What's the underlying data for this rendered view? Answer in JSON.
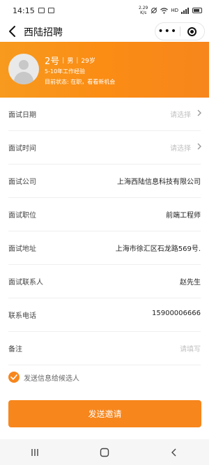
{
  "statusbar": {
    "time": "14:15",
    "speed_top": "2.29",
    "speed_bottom": "K/s",
    "network_label": "HD"
  },
  "nav": {
    "title": "西陆招聘",
    "more_glyph": "•••"
  },
  "candidate": {
    "name": "2号",
    "gender": "男",
    "age": "29岁",
    "experience": "5-10年工作经验",
    "status": "目前状态: 在职，看看新机会"
  },
  "form": {
    "rows": [
      {
        "label": "面试日期",
        "value": "请选择",
        "placeholder": true,
        "chevron": true
      },
      {
        "label": "面试时间",
        "value": "请选择",
        "placeholder": true,
        "chevron": true
      },
      {
        "label": "面试公司",
        "value": "上海西陆信息科技有限公司",
        "placeholder": false,
        "chevron": false
      },
      {
        "label": "面试职位",
        "value": "前端工程师",
        "placeholder": false,
        "chevron": false
      },
      {
        "label": "面试地址",
        "value": "上海市徐汇区石龙路569号.",
        "placeholder": false,
        "chevron": false
      },
      {
        "label": "面试联系人",
        "value": "赵先生",
        "placeholder": false,
        "chevron": false
      },
      {
        "label": "联系电话",
        "value": "15900006666",
        "placeholder": false,
        "chevron": false
      },
      {
        "label": "备注",
        "value": "请填写",
        "placeholder": true,
        "chevron": false
      }
    ]
  },
  "notify": {
    "checked": true,
    "label": "发送信息给候选人"
  },
  "actions": {
    "send_label": "发送邀请"
  },
  "colors": {
    "accent": "#f7861c",
    "header_start": "#f79a1e"
  },
  "icons": {
    "back": "chevron-left-icon",
    "chevron": "chevron-right-icon",
    "check": "check-icon",
    "target": "target-icon",
    "recents": "recents-icon",
    "home": "home-icon",
    "back_system": "back-icon"
  }
}
